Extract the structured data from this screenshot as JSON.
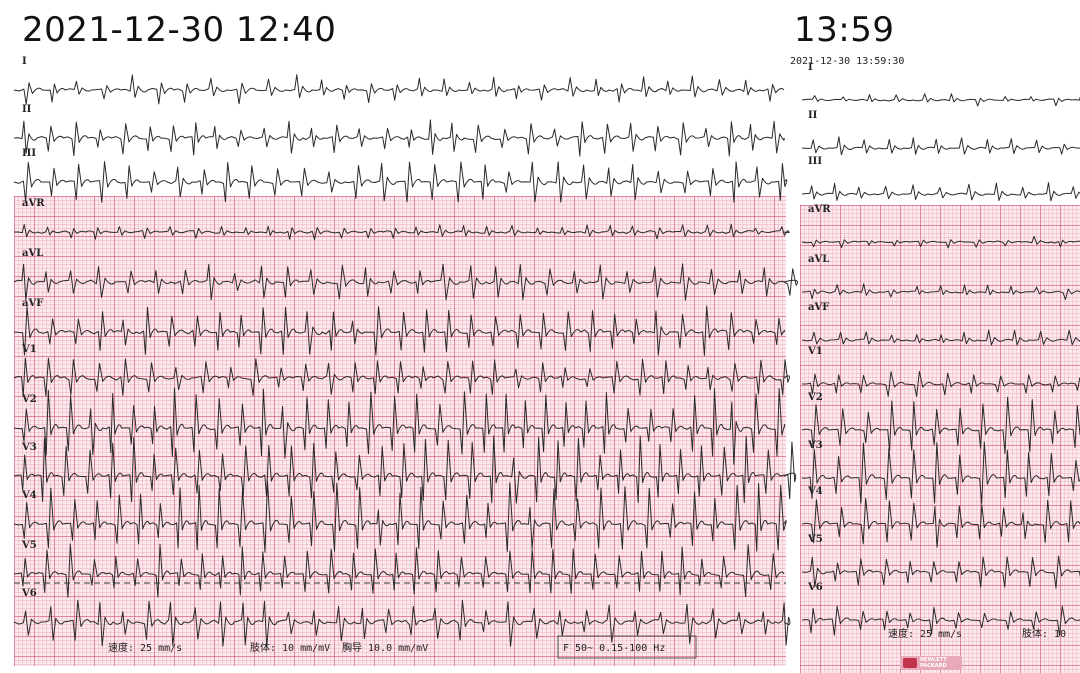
{
  "left": {
    "title": "2021-12-30 12:40",
    "leads": [
      "I",
      "II",
      "III",
      "aVR",
      "aVL",
      "aVF",
      "V1",
      "V2",
      "V3",
      "V4",
      "V5",
      "V6"
    ],
    "footer": {
      "speed": "速度:  25 mm/s",
      "limb": "肢体:  10 mm/mV",
      "chest": "胸导  10.0 mm/mV",
      "filter": "F 50~ 0.15-100 Hz"
    }
  },
  "right": {
    "title": "13:59",
    "timestamp": "2021-12-30 13:59:30",
    "leads": [
      "I",
      "II",
      "III",
      "aVR",
      "aVL",
      "aVF",
      "V1",
      "V2",
      "V3",
      "V4",
      "V5",
      "V6"
    ],
    "footer": {
      "speed": "速度:  25 mm/s",
      "limb": "肢体:  10"
    },
    "logo_lines": [
      "HEWLETT",
      "PACKARD"
    ]
  },
  "colors": {
    "grid_background": "#fbe9ee",
    "grid_line": "#d6506e",
    "trace": "#2a2a2a"
  }
}
